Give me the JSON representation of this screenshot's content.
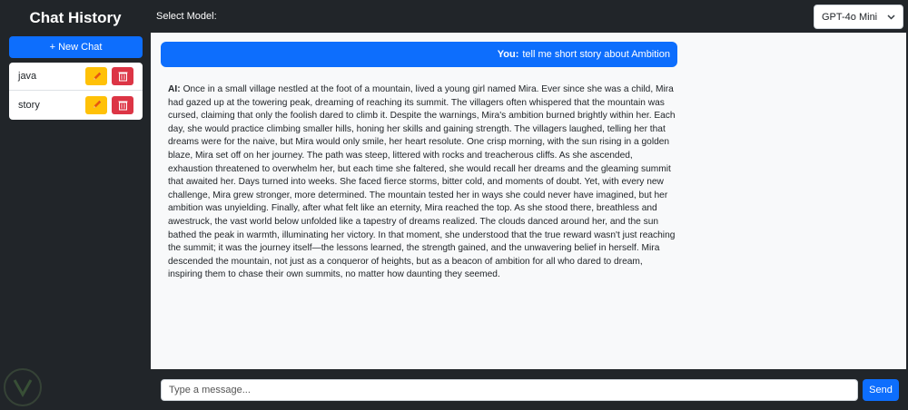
{
  "sidebar": {
    "title": "Chat History",
    "new_chat_label": "+ New Chat",
    "chats": [
      {
        "label": "java"
      },
      {
        "label": "story"
      }
    ]
  },
  "topbar": {
    "model_label": "Select Model:",
    "model_selected": "GPT-4o Mini"
  },
  "conversation": {
    "user_prefix": "You:",
    "user_text": "tell me short story about Ambition",
    "ai_prefix": "AI:",
    "ai_text": "Once in a small village nestled at the foot of a mountain, lived a young girl named Mira. Ever since she was a child, Mira had gazed up at the towering peak, dreaming of reaching its summit. The villagers often whispered that the mountain was cursed, claiming that only the foolish dared to climb it. Despite the warnings, Mira's ambition burned brightly within her. Each day, she would practice climbing smaller hills, honing her skills and gaining strength. The villagers laughed, telling her that dreams were for the naive, but Mira would only smile, her heart resolute. One crisp morning, with the sun rising in a golden blaze, Mira set off on her journey. The path was steep, littered with rocks and treacherous cliffs. As she ascended, exhaustion threatened to overwhelm her, but each time she faltered, she would recall her dreams and the gleaming summit that awaited her. Days turned into weeks. She faced fierce storms, bitter cold, and moments of doubt. Yet, with every new challenge, Mira grew stronger, more determined. The mountain tested her in ways she could never have imagined, but her ambition was unyielding. Finally, after what felt like an eternity, Mira reached the top. As she stood there, breathless and awestruck, the vast world below unfolded like a tapestry of dreams realized. The clouds danced around her, and the sun bathed the peak in warmth, illuminating her victory. In that moment, she understood that the true reward wasn't just reaching the summit; it was the journey itself—the lessons learned, the strength gained, and the unwavering belief in herself. Mira descended the mountain, not just as a conqueror of heights, but as a beacon of ambition for all who dared to dream, inspiring them to chase their own summits, no matter how daunting they seemed."
  },
  "composer": {
    "placeholder": "Type a message...",
    "value": "",
    "send_label": "Send"
  },
  "icons": {
    "edit": "pencil-icon",
    "delete": "trash-icon",
    "dropdown": "chevron-down-icon"
  },
  "colors": {
    "background": "#212529",
    "primary": "#0d6efd",
    "warning": "#ffc107",
    "danger": "#dc3545",
    "chat_bg": "#f8f9fa"
  }
}
